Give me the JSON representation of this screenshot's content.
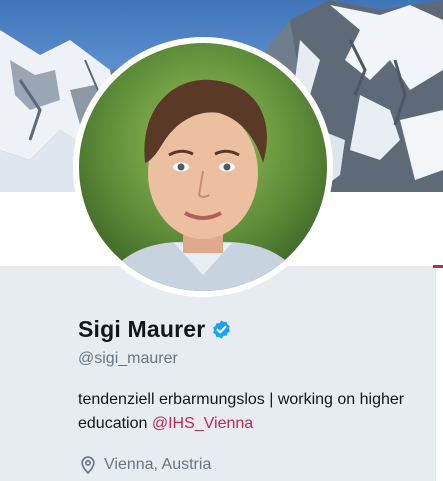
{
  "profile": {
    "display_name": "Sigi Maurer",
    "handle": "@sigi_maurer",
    "verified": true,
    "bio_text": "tendenziell erbarmungslos | working on higher education ",
    "bio_mention": "@IHS_Vienna",
    "location": "Vienna, Austria"
  },
  "colors": {
    "accent": "#c4274f",
    "verified_badge": "#1da1f2",
    "card_background": "#e6ecf0",
    "secondary_text": "#657786"
  },
  "icons": {
    "verified": "verified-badge-icon",
    "location": "location-pin-icon"
  }
}
